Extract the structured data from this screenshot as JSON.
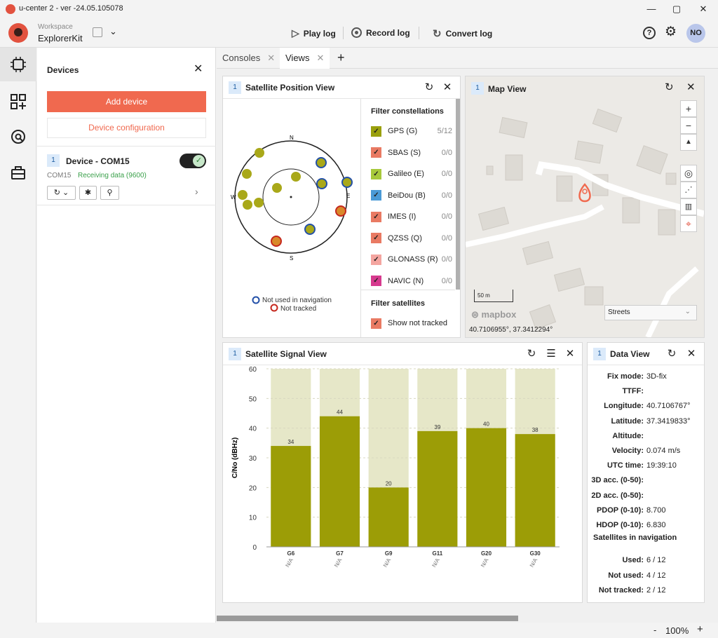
{
  "window": {
    "title": "u-center 2 - ver -24.05.105078",
    "min": "—",
    "max": "▢",
    "close": "✕"
  },
  "toolbar": {
    "workspace_label": "Workspace",
    "workspace_name": "ExplorerKit",
    "play_log": "Play log",
    "record_log": "Record log",
    "convert_log": "Convert log",
    "user_initials": "NO"
  },
  "devices_pane": {
    "title": "Devices",
    "add_device": "Add device",
    "device_configuration": "Device configuration",
    "device": {
      "index": "1",
      "name": "Device - COM15",
      "port": "COM15",
      "status": "Receiving data (9600)"
    }
  },
  "tabs": [
    {
      "label": "Consoles"
    },
    {
      "label": "Views"
    }
  ],
  "satellite_position_view": {
    "index": "1",
    "title": "Satellite Position View",
    "compass": {
      "n": "N",
      "s": "S",
      "e": "E",
      "w": "W"
    },
    "legend": {
      "not_used": "Not used in navigation",
      "not_tracked": "Not tracked"
    },
    "filter_constellations_title": "Filter constellations",
    "constellations": [
      {
        "name": "GPS (G)",
        "count": "5/12",
        "color": "#9aa00d",
        "checked": true
      },
      {
        "name": "SBAS (S)",
        "count": "0/0",
        "color": "#e97a63",
        "checked": true
      },
      {
        "name": "Galileo (E)",
        "count": "0/0",
        "color": "#a7c93b",
        "checked": true
      },
      {
        "name": "BeiDou (B)",
        "count": "0/0",
        "color": "#4a9ad6",
        "checked": true
      },
      {
        "name": "IMES (I)",
        "count": "0/0",
        "color": "#e97a63",
        "checked": true
      },
      {
        "name": "QZSS (Q)",
        "count": "0/0",
        "color": "#e97a63",
        "checked": true
      },
      {
        "name": "GLONASS (R)",
        "count": "0/0",
        "color": "#f4a5a0",
        "checked": true
      },
      {
        "name": "NAVIC (N)",
        "count": "0/0",
        "color": "#d63a8e",
        "checked": true
      }
    ],
    "filter_satellites_title": "Filter satellites",
    "show_not_tracked": "Show not tracked"
  },
  "map_view": {
    "index": "1",
    "title": "Map View",
    "scale": "50 m",
    "brand": "mapbox",
    "style": "Streets",
    "coords": "40.7106955°, 37.3412294°"
  },
  "satellite_signal_view": {
    "index": "1",
    "title": "Satellite Signal View"
  },
  "data_view": {
    "index": "1",
    "title": "Data View",
    "rows": [
      {
        "k": "Fix mode:",
        "v": "3D-fix"
      },
      {
        "k": "TTFF:",
        "v": ""
      },
      {
        "k": "Longitude:",
        "v": "40.7106767°"
      },
      {
        "k": "Latitude:",
        "v": "37.3419833°"
      },
      {
        "k": "Altitude:",
        "v": ""
      },
      {
        "k": "Velocity:",
        "v": "0.074 m/s"
      },
      {
        "k": "UTC time:",
        "v": "19:39:10"
      },
      {
        "k": "3D acc. (0-50):",
        "v": ""
      },
      {
        "k": "2D acc. (0-50):",
        "v": ""
      },
      {
        "k": "PDOP (0-10):",
        "v": "8.700"
      },
      {
        "k": "HDOP (0-10):",
        "v": "6.830"
      }
    ],
    "sat_nav_title": "Satellites in navigation",
    "sat_rows": [
      {
        "k": "Used:",
        "v": "6 / 12"
      },
      {
        "k": "Not used:",
        "v": "4 / 12"
      },
      {
        "k": "Not tracked:",
        "v": "2 / 12"
      }
    ]
  },
  "status": {
    "minus": "-",
    "zoom": "100%",
    "plus": "+"
  },
  "chart_data": {
    "type": "bar",
    "categories": [
      "G6",
      "G7",
      "G9",
      "G11",
      "G20",
      "G30"
    ],
    "sublabels": [
      "N/A",
      "N/A",
      "N/A",
      "N/A",
      "N/A",
      "N/A"
    ],
    "values": [
      34,
      44,
      20,
      39,
      40,
      38
    ],
    "ylabel": "C/No (dBHz)",
    "ylim": [
      0,
      60
    ],
    "yticks": [
      0,
      10,
      20,
      30,
      40,
      50,
      60
    ],
    "bar_color": "#9c9d06",
    "bg_color": "#e6e7c8"
  }
}
